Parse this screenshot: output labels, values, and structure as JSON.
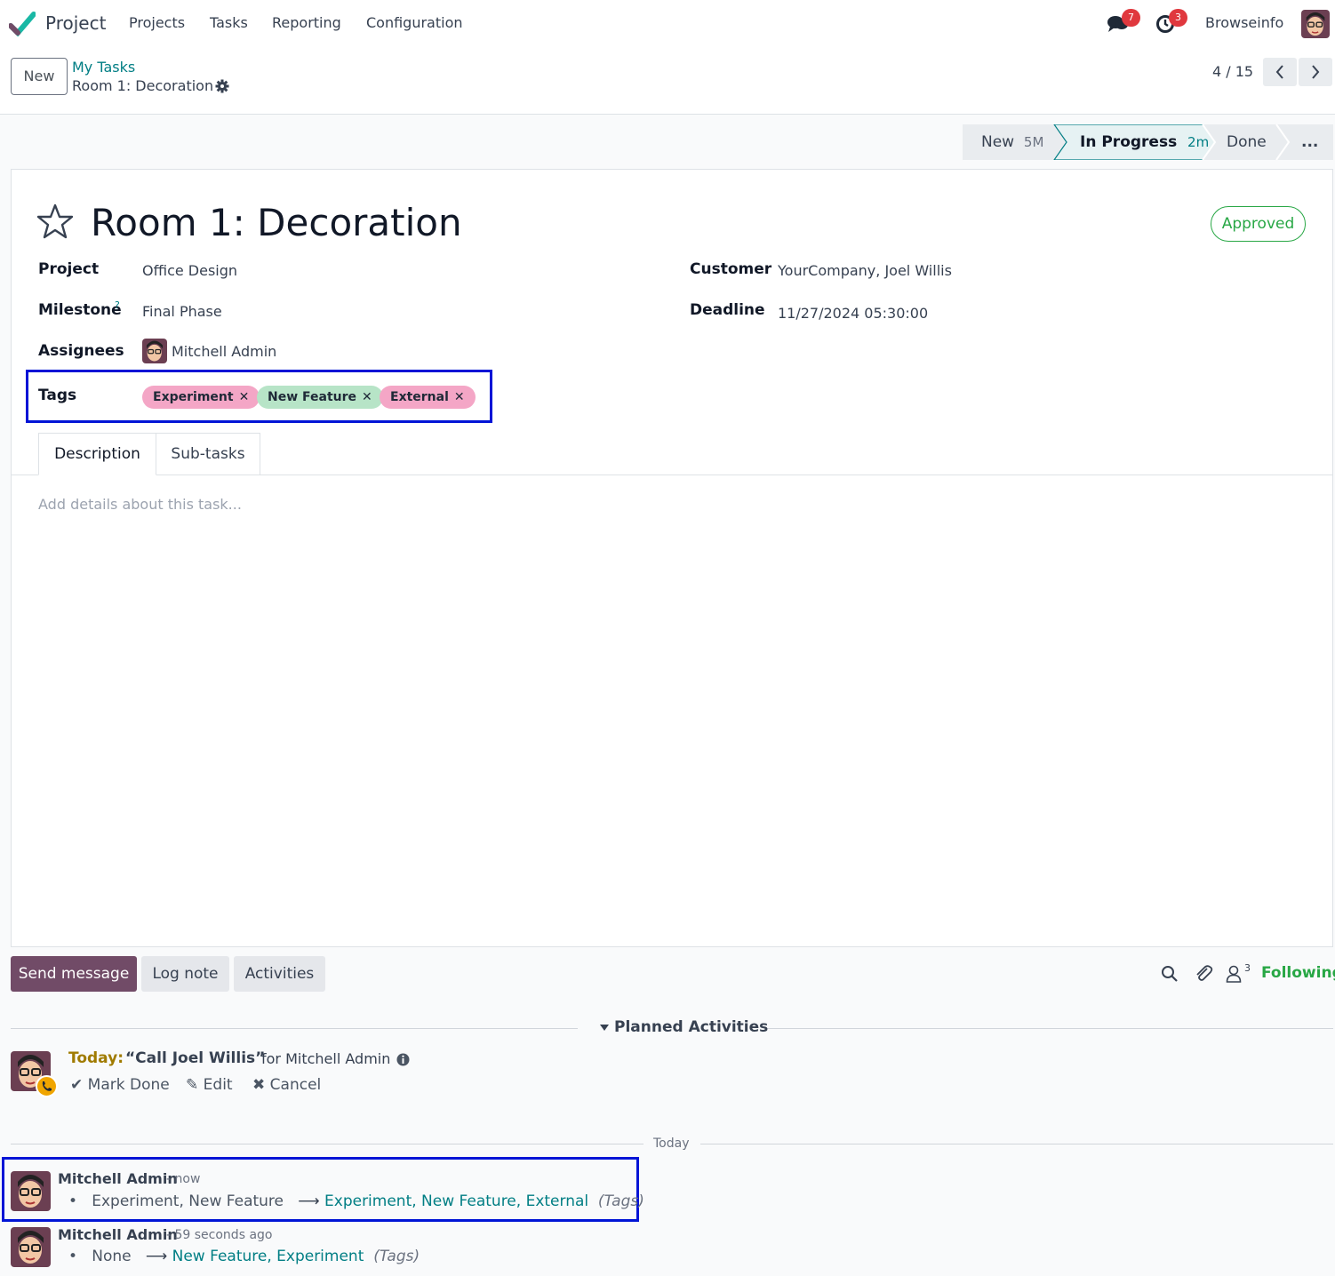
{
  "navbar": {
    "app_name": "Project",
    "menu": [
      "Projects",
      "Tasks",
      "Reporting",
      "Configuration"
    ],
    "messages_count": "7",
    "activities_count": "3",
    "company": "Browseinfo",
    "icons": [
      "chat-icon",
      "clock-icon"
    ]
  },
  "control": {
    "new_label": "New",
    "breadcrumb_parent": "My Tasks",
    "breadcrumb_current": "Room 1: Decoration",
    "pager": "4 / 15"
  },
  "stages": [
    {
      "name": "New",
      "duration": "5M"
    },
    {
      "name": "In Progress",
      "duration": "2m"
    },
    {
      "name": "Done",
      "duration": ""
    },
    {
      "name": "...",
      "duration": ""
    }
  ],
  "task": {
    "title": "Room 1: Decoration",
    "status": "Approved",
    "fields": {
      "project_label": "Project",
      "project": "Office Design",
      "milestone_label": "Milestone",
      "milestone_help": "?",
      "milestone": "Final Phase",
      "assignees_label": "Assignees",
      "assignee": "Mitchell Admin",
      "customer_label": "Customer",
      "customer": "YourCompany, Joel Willis",
      "deadline_label": "Deadline",
      "deadline": "11/27/2024 05:30:00",
      "tags_label": "Tags"
    },
    "tags": [
      {
        "name": "Experiment",
        "color": "#f4a6c6"
      },
      {
        "name": "New Feature",
        "color": "#b7e4c7"
      },
      {
        "name": "External",
        "color": "#f4a6c6"
      }
    ],
    "tabs": [
      "Description",
      "Sub-tasks"
    ],
    "description_placeholder": "Add details about this task..."
  },
  "chatter": {
    "send_message": "Send message",
    "log_note": "Log note",
    "activities": "Activities",
    "followers_count": "3",
    "following": "Following",
    "planned_title": "Planned Activities",
    "activity": {
      "when": "Today:",
      "summary": "“Call Joel Willis”",
      "for": "for Mitchell Admin",
      "mark_done": "Mark Done",
      "edit": "Edit",
      "cancel": "Cancel"
    },
    "date_separator": "Today",
    "messages": [
      {
        "author": "Mitchell Admin",
        "time": "- now",
        "old": "Experiment, New Feature",
        "arrow": "⟶",
        "new": "Experiment, New Feature, External",
        "field": "(Tags)"
      },
      {
        "author": "Mitchell Admin",
        "time": "- 59 seconds ago",
        "old": "None",
        "arrow": "⟶",
        "new": "New Feature, Experiment",
        "field": "(Tags)"
      }
    ]
  },
  "colors": {
    "primary": "#714b67",
    "teal": "#017e84",
    "approved": "#28a745",
    "highlight": "#0014d6"
  }
}
